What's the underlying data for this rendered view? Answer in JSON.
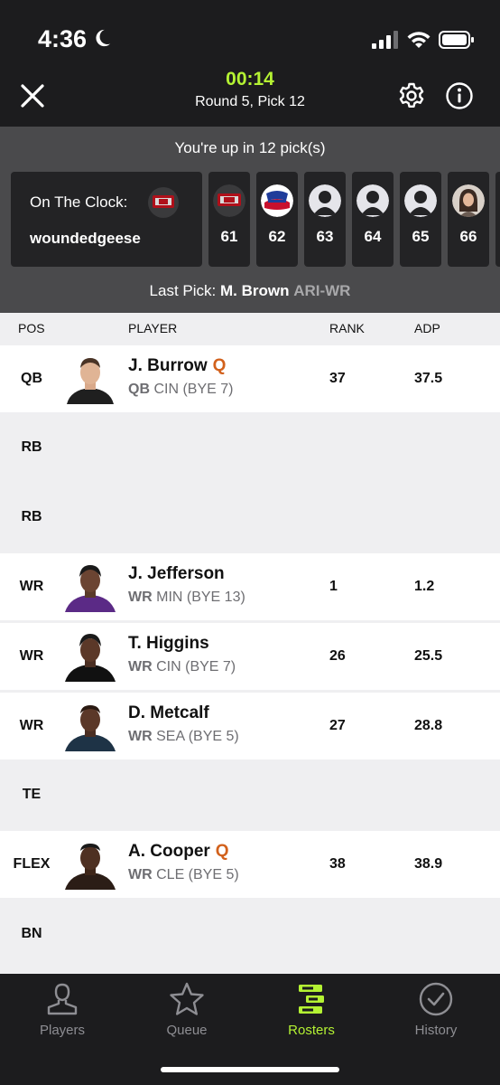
{
  "status": {
    "time": "4:36"
  },
  "header": {
    "timer": "00:14",
    "round_info": "Round 5, Pick 12"
  },
  "draft": {
    "up_in": "You're up in 12 pick(s)",
    "on_clock_label": "On The Clock:",
    "on_clock_user": "woundedgeese",
    "picks": [
      {
        "number": "61",
        "avatar": "team-logo"
      },
      {
        "number": "62",
        "avatar": "wrecked-logo"
      },
      {
        "number": "63",
        "avatar": "default-avatar"
      },
      {
        "number": "64",
        "avatar": "default-avatar"
      },
      {
        "number": "65",
        "avatar": "default-avatar"
      },
      {
        "number": "66",
        "avatar": "user-photo"
      }
    ],
    "last_pick_label": "Last Pick:",
    "last_pick_player": "M. Brown",
    "last_pick_pos": "ARI-WR"
  },
  "roster": {
    "columns": {
      "pos": "POS",
      "player": "PLAYER",
      "rank": "RANK",
      "adp": "ADP"
    },
    "rows": [
      {
        "slot": "QB",
        "name": "J. Burrow",
        "tag": "Q",
        "pos": "QB",
        "team_bye": "CIN (BYE 7)",
        "rank": "37",
        "adp": "37.5"
      },
      {
        "slot": "RB"
      },
      {
        "slot": "RB"
      },
      {
        "slot": "WR",
        "name": "J. Jefferson",
        "tag": "",
        "pos": "WR",
        "team_bye": "MIN (BYE 13)",
        "rank": "1",
        "adp": "1.2"
      },
      {
        "slot": "WR",
        "name": "T. Higgins",
        "tag": "",
        "pos": "WR",
        "team_bye": "CIN (BYE 7)",
        "rank": "26",
        "adp": "25.5"
      },
      {
        "slot": "WR",
        "name": "D. Metcalf",
        "tag": "",
        "pos": "WR",
        "team_bye": "SEA (BYE 5)",
        "rank": "27",
        "adp": "28.8"
      },
      {
        "slot": "TE"
      },
      {
        "slot": "FLEX",
        "name": "A. Cooper",
        "tag": "Q",
        "pos": "WR",
        "team_bye": "CLE (BYE 5)",
        "rank": "38",
        "adp": "38.9"
      },
      {
        "slot": "BN"
      }
    ]
  },
  "tabs": [
    {
      "label": "Players",
      "icon": "person-icon",
      "active": false
    },
    {
      "label": "Queue",
      "icon": "star-icon",
      "active": false
    },
    {
      "label": "Rosters",
      "icon": "roster-icon",
      "active": true
    },
    {
      "label": "History",
      "icon": "check-circle-icon",
      "active": false
    }
  ],
  "colors": {
    "accent": "#b4f233",
    "injury": "#d2611c"
  }
}
